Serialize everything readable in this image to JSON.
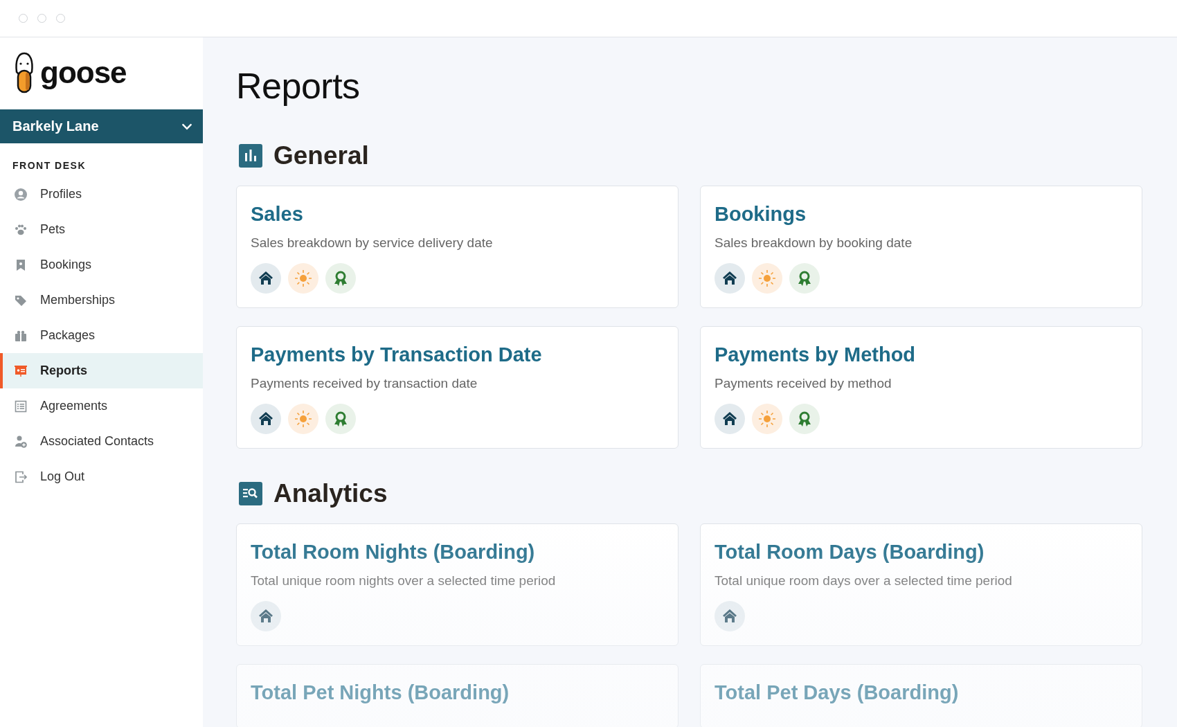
{
  "brand": {
    "name": "goose"
  },
  "location_picker": {
    "value": "Barkely Lane",
    "expanded": false
  },
  "sidebar": {
    "section": "FRONT DESK",
    "items": [
      {
        "label": "Profiles",
        "selected": false
      },
      {
        "label": "Pets",
        "selected": false
      },
      {
        "label": "Bookings",
        "selected": false
      },
      {
        "label": "Memberships",
        "selected": false
      },
      {
        "label": "Packages",
        "selected": false
      },
      {
        "label": "Reports",
        "selected": true
      },
      {
        "label": "Agreements",
        "selected": false
      },
      {
        "label": "Associated Contacts",
        "selected": false
      },
      {
        "label": "Log Out",
        "selected": false
      }
    ]
  },
  "page": {
    "title": "Reports"
  },
  "sections": [
    {
      "title": "General",
      "kind": "chart",
      "cards": [
        {
          "title": "Sales",
          "description": "Sales breakdown by service delivery date",
          "services": [
            {
              "kind": "house"
            },
            {
              "kind": "sun"
            },
            {
              "kind": "ribbon"
            }
          ]
        },
        {
          "title": "Bookings",
          "description": "Sales breakdown by booking date",
          "services": [
            {
              "kind": "house"
            },
            {
              "kind": "sun"
            },
            {
              "kind": "ribbon"
            }
          ]
        },
        {
          "title": "Payments by Transaction Date",
          "description": "Payments received by transaction date",
          "services": [
            {
              "kind": "house"
            },
            {
              "kind": "sun"
            },
            {
              "kind": "ribbon"
            }
          ]
        },
        {
          "title": "Payments by Method",
          "description": "Payments received by method",
          "services": [
            {
              "kind": "house"
            },
            {
              "kind": "sun"
            },
            {
              "kind": "ribbon"
            }
          ]
        }
      ]
    },
    {
      "title": "Analytics",
      "kind": "search",
      "cards": [
        {
          "title": "Total Room Nights (Boarding)",
          "description": "Total unique room nights over a selected time period",
          "services": [
            {
              "kind": "house"
            }
          ]
        },
        {
          "title": "Total Room Days (Boarding)",
          "description": "Total unique room days over a selected time period",
          "services": [
            {
              "kind": "house"
            }
          ]
        },
        {
          "title": "Total Pet Nights (Boarding)"
        },
        {
          "title": "Total Pet Days (Boarding)"
        }
      ]
    }
  ]
}
